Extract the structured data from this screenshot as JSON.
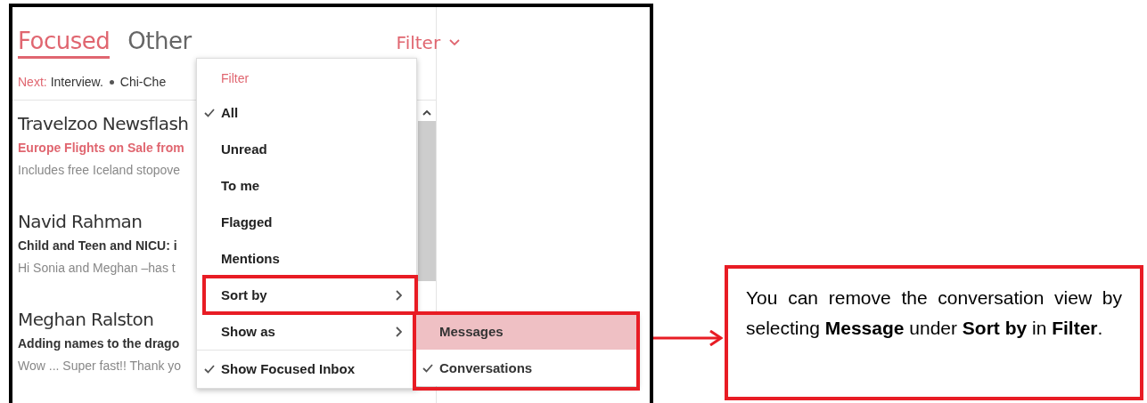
{
  "tabs": [
    {
      "label": "Focused",
      "selected": true
    },
    {
      "label": "Other",
      "selected": false
    }
  ],
  "filter_button": {
    "label": "Filter"
  },
  "next": {
    "label": "Next:",
    "items": [
      "Interview.",
      "Chi-Che"
    ]
  },
  "messages": [
    {
      "sender": "Travelzoo Newsflash",
      "subject": "Europe Flights on Sale from",
      "preview": "Includes free Iceland stopove",
      "highlighted": true
    },
    {
      "sender": "Navid Rahman",
      "subject": "Child and Teen and NICU: i",
      "preview": "Hi Sonia and Meghan –has t",
      "highlighted": false
    },
    {
      "sender": "Meghan Ralston",
      "subject": "Adding names to the drago",
      "preview": "Wow ... Super fast!! Thank yo",
      "highlighted": false
    }
  ],
  "filter_menu": {
    "title": "Filter",
    "items": [
      {
        "label": "All",
        "kind": "option",
        "checked": true
      },
      {
        "label": "Unread",
        "kind": "option",
        "checked": false
      },
      {
        "label": "To me",
        "kind": "option",
        "checked": false
      },
      {
        "label": "Flagged",
        "kind": "option",
        "checked": false
      },
      {
        "label": "Mentions",
        "kind": "option",
        "checked": false
      },
      {
        "label": "Sort by",
        "kind": "submenu",
        "highlighted": true
      },
      {
        "label": "Show as",
        "kind": "submenu",
        "highlighted": false
      },
      {
        "label": "Show Focused Inbox",
        "kind": "toggle",
        "checked": true
      }
    ]
  },
  "sort_submenu": {
    "highlighted": true,
    "items": [
      {
        "label": "Messages",
        "selected": true,
        "checked": false
      },
      {
        "label": "Conversations",
        "selected": false,
        "checked": true
      }
    ]
  },
  "callout": {
    "text": "You can remove the conversation view by selecting **Message** under **Sort by** in **Filter**."
  }
}
